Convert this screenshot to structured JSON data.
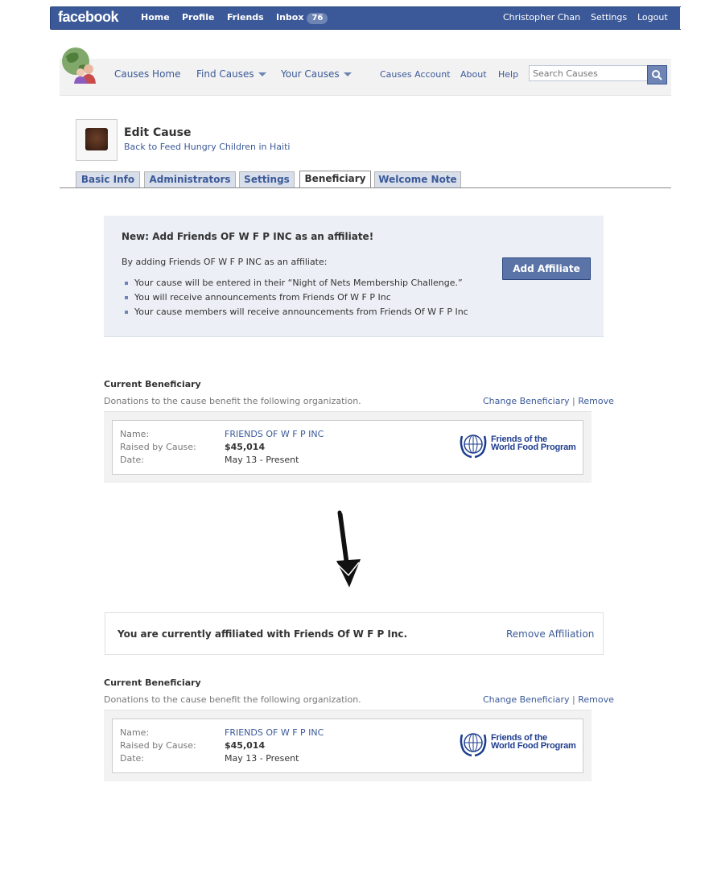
{
  "topbar": {
    "logo": "facebook",
    "nav": [
      "Home",
      "Profile",
      "Friends",
      "Inbox"
    ],
    "inbox_count": "76",
    "user": "Christopher Chan",
    "settings": "Settings",
    "logout": "Logout"
  },
  "causes_nav": {
    "home": "Causes Home",
    "find": "Find Causes",
    "yours": "Your Causes",
    "account": "Causes Account",
    "about": "About",
    "help": "Help",
    "search_placeholder": "Search Causes"
  },
  "edit": {
    "title": "Edit Cause",
    "back_link": "Back to Feed Hungry Children in Haiti"
  },
  "tabs": [
    {
      "label": "Basic Info",
      "active": false
    },
    {
      "label": "Administrators",
      "active": false
    },
    {
      "label": "Settings",
      "active": false
    },
    {
      "label": "Beneficiary",
      "active": true
    },
    {
      "label": "Welcome Note",
      "active": false
    }
  ],
  "affiliate": {
    "title": "New: Add Friends OF W F P INC as an affiliate!",
    "intro": "By adding Friends OF W F P INC as an affiliate:",
    "bullets": [
      "Your cause will be entered in their “Night of Nets Membership Challenge.”",
      "You will receive announcements from Friends Of W F P Inc",
      "Your cause members will receive announcements from Friends Of W F P Inc"
    ],
    "button": "Add Affiliate"
  },
  "beneficiary": {
    "title": "Current Beneficiary",
    "subtitle": "Donations to the cause benefit the following organization.",
    "change": "Change Beneficiary",
    "separator": "|",
    "remove": "Remove",
    "labels": {
      "name": "Name:",
      "raised": "Raised by Cause:",
      "date": "Date:"
    },
    "name": "FRIENDS OF W F P INC",
    "raised": "$45,014",
    "date": "May 13 - Present",
    "logo_line1": "Friends of the",
    "logo_line2": "World Food Program"
  },
  "affiliated": {
    "text": "You are currently affiliated with Friends Of W F P Inc.",
    "remove": "Remove Affiliation"
  },
  "colors": {
    "brand": "#3b5998",
    "affiliate_bg": "#eceff5",
    "button": "#5b74a8"
  }
}
